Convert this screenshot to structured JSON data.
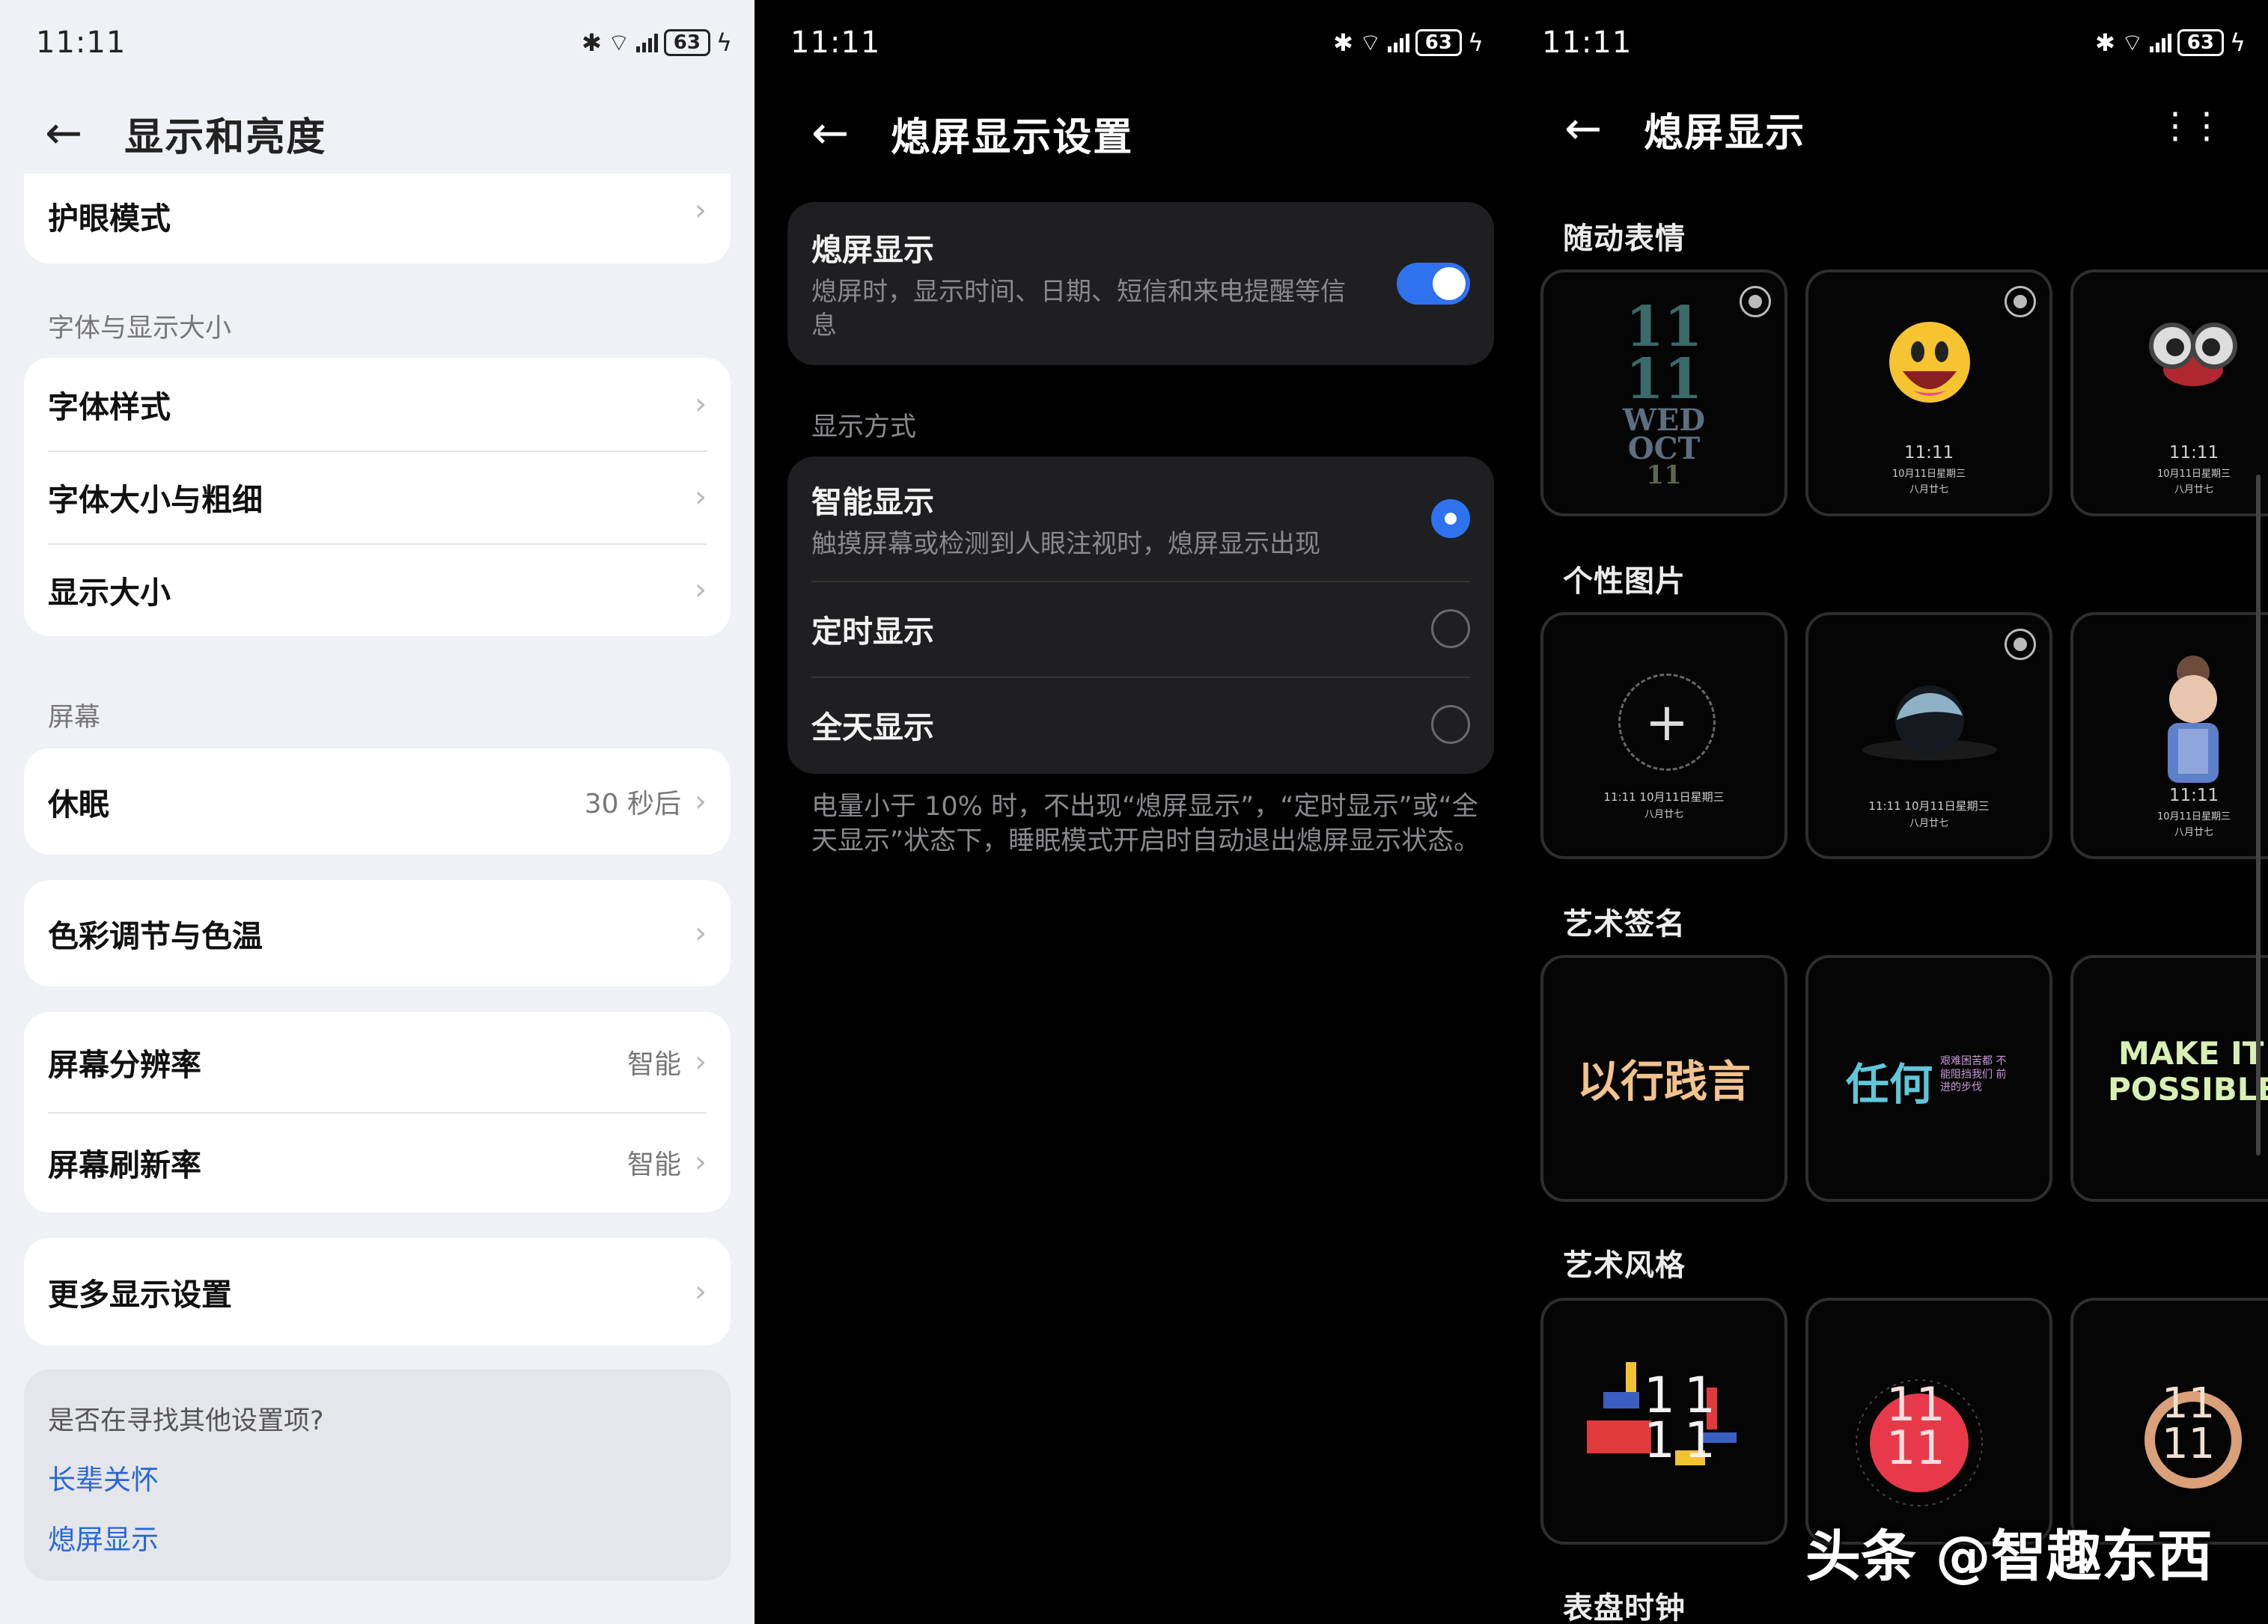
{
  "status": {
    "time": "11:11",
    "battery": "63"
  },
  "panel1": {
    "title": "显示和亮度",
    "eye_mode": "护眼模式",
    "section_font": "字体与显示大小",
    "font_style": "字体样式",
    "font_size": "字体大小与粗细",
    "display_size": "显示大小",
    "section_screen": "屏幕",
    "sleep": "休眠",
    "sleep_value": "30 秒后",
    "color": "色彩调节与色温",
    "resolution": "屏幕分辨率",
    "resolution_value": "智能",
    "refresh": "屏幕刷新率",
    "refresh_value": "智能",
    "more": "更多显示设置",
    "help_q": "是否在寻找其他设置项?",
    "help_link1": "长辈关怀",
    "help_link2": "熄屏显示"
  },
  "panel2": {
    "title": "熄屏显示设置",
    "aod": "熄屏显示",
    "aod_desc": "熄屏时，显示时间、日期、短信和来电提醒等信息",
    "aod_enabled": true,
    "mode_label": "显示方式",
    "smart": "智能显示",
    "smart_desc": "触摸屏幕或检测到人眼注视时，熄屏显示出现",
    "timed": "定时显示",
    "allday": "全天显示",
    "selected": "智能显示",
    "note": "电量小于 10% 时，不出现“熄屏显示”，“定时显示”或“全天显示”状态下，睡眠模式开启时自动退出熄屏显示状态。"
  },
  "panel3": {
    "title": "熄屏显示",
    "sec1": "随动表情",
    "sec2": "个性图片",
    "sec3": "艺术签名",
    "sec4": "艺术风格",
    "sec5": "表盘时钟",
    "clock_time": "11:11",
    "clock_date": "10月11日星期三",
    "clock_lunar": "八月廿七",
    "clock_line": "11:11 10月11日星期三",
    "tile1_h": "11",
    "tile1_m": "11",
    "tile1_day": "WED",
    "tile1_mon": "OCT",
    "tile1_dnum": "11",
    "sig1": "以行践言",
    "sig2_big": "任何",
    "sig2_small": "艰难困苦都 不能阻挡我们 前进的步伐",
    "sig3_l1": "MAKE IT",
    "sig3_l2": "POSSIBLE",
    "art_num": "11",
    "add_glyph": "+",
    "more_glyph": "⋮⋮"
  },
  "watermark": "头条 @智趣东西"
}
